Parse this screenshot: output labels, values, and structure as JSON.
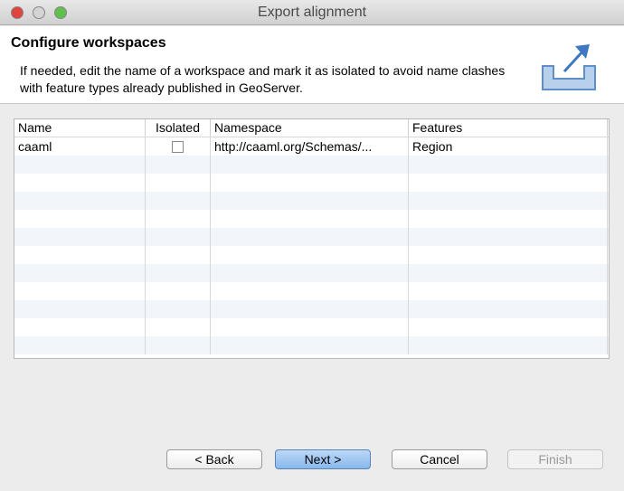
{
  "window": {
    "title": "Export alignment"
  },
  "header": {
    "title": "Configure workspaces",
    "description": "If needed, edit the name of a workspace and mark it as isolated to avoid name clashes with feature types already published in GeoServer.",
    "icon": "export-icon"
  },
  "table": {
    "columns": [
      "Name",
      "Isolated",
      "Namespace",
      "Features"
    ],
    "rows": [
      {
        "name": "caaml",
        "isolated": false,
        "namespace": "http://caaml.org/Schemas/...",
        "features": "Region"
      }
    ]
  },
  "buttons": {
    "back": "< Back",
    "next": "Next >",
    "cancel": "Cancel",
    "finish": "Finish"
  }
}
